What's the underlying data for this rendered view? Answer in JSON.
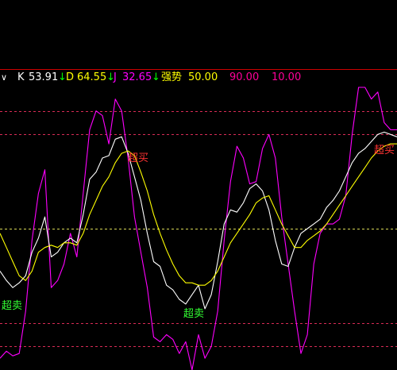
{
  "colors": {
    "background": "#000000",
    "k": "#ffffff",
    "d": "#ffff00",
    "j": "#ff00ff",
    "level_line": "#ff3366",
    "mid_line": "#ffff66",
    "down_arrow": "#00ff00",
    "overbought_text": "#ff3333",
    "oversold_text": "#33ff33",
    "divider": "#cc0000"
  },
  "legend": {
    "marker": "∨",
    "k_label": "K",
    "k_value": "53.91",
    "d_label": "D",
    "d_value": "64.55",
    "j_label": "J",
    "j_value": "32.65",
    "arrow": "↓",
    "strength_label": "强势",
    "strength_value": "50.00",
    "upper_value": "90.00",
    "lower_value": "10.00"
  },
  "annotations": {
    "overbought": "超买",
    "oversold": "超卖"
  },
  "chart_data": {
    "type": "line",
    "ylim": [
      -10,
      110
    ],
    "x": [
      0,
      1,
      2,
      3,
      4,
      5,
      6,
      7,
      8,
      9,
      10,
      11,
      12,
      13,
      14,
      15,
      16,
      17,
      18,
      19,
      20,
      21,
      22,
      23,
      24,
      25,
      26,
      27,
      28,
      29,
      30,
      31,
      32,
      33,
      34,
      35,
      36,
      37,
      38,
      39,
      40,
      41,
      42,
      43,
      44,
      45,
      46,
      47,
      48,
      49,
      50,
      51,
      52,
      53,
      54,
      55,
      56,
      57,
      58,
      59,
      60,
      61,
      62
    ],
    "reference_lines": [
      {
        "value": 100,
        "style": "dashed",
        "color": "#ff3366"
      },
      {
        "value": 90,
        "style": "dashed",
        "color": "#ff3366"
      },
      {
        "value": 50,
        "style": "dashed",
        "color": "#ffff66"
      },
      {
        "value": 10,
        "style": "dashed",
        "color": "#ff3366"
      },
      {
        "value": 0,
        "style": "dashed",
        "color": "#ff3366"
      }
    ],
    "series": [
      {
        "name": "J",
        "color": "#ff00ff",
        "values": [
          -5,
          -2,
          -4,
          -3,
          15,
          45,
          65,
          75,
          25,
          28,
          35,
          48,
          38,
          65,
          92,
          100,
          98,
          86,
          105,
          100,
          80,
          55,
          40,
          25,
          4,
          2,
          5,
          3,
          -3,
          2,
          -10,
          5,
          -5,
          0,
          15,
          45,
          70,
          85,
          80,
          69,
          70,
          84,
          90,
          80,
          55,
          35,
          15,
          -3,
          5,
          35,
          48,
          52,
          52,
          54,
          64,
          90,
          110,
          110,
          105,
          108,
          95,
          92,
          92
        ]
      },
      {
        "name": "K",
        "color": "#ffffff",
        "values": [
          32,
          28,
          25,
          27,
          30,
          40,
          46,
          55,
          38,
          40,
          44,
          46,
          44,
          56,
          71,
          74,
          80,
          81,
          88,
          89,
          82,
          72,
          62,
          48,
          36,
          34,
          26,
          24,
          20,
          18,
          22,
          26,
          16,
          22,
          36,
          52,
          58,
          57,
          61,
          67,
          69,
          66,
          58,
          45,
          35,
          34,
          42,
          48,
          50,
          52,
          54,
          59,
          62,
          66,
          72,
          78,
          82,
          84,
          87,
          90,
          91,
          90,
          89
        ]
      },
      {
        "name": "D",
        "color": "#ffff00",
        "values": [
          48,
          42,
          36,
          30,
          28,
          32,
          40,
          42,
          43,
          42,
          44,
          44,
          43,
          48,
          56,
          62,
          68,
          72,
          78,
          82,
          83,
          81,
          74,
          66,
          56,
          48,
          41,
          35,
          30,
          27,
          27,
          26,
          26,
          28,
          32,
          38,
          44,
          48,
          52,
          56,
          61,
          63,
          64,
          58,
          52,
          47,
          42,
          42,
          45,
          47,
          49,
          52,
          56,
          60,
          64,
          68,
          72,
          76,
          80,
          83,
          85,
          86,
          86
        ]
      }
    ]
  }
}
